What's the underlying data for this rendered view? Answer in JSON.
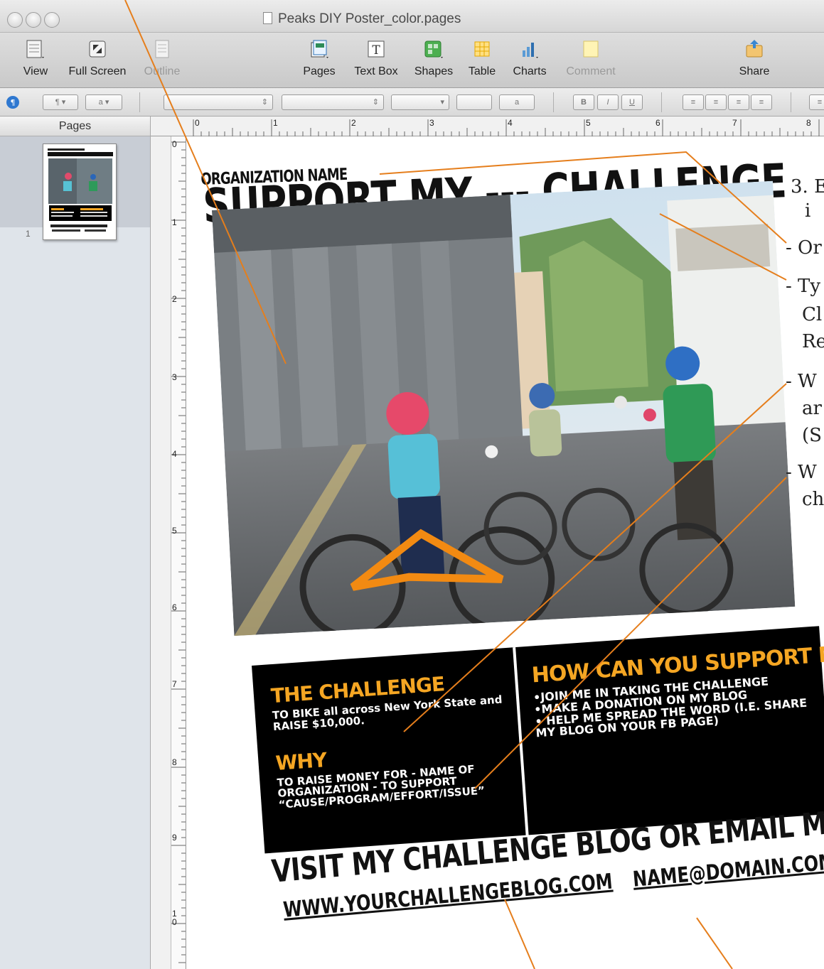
{
  "window": {
    "title": "Peaks DIY Poster_color.pages"
  },
  "toolbar": {
    "view": "View",
    "full_screen": "Full Screen",
    "outline": "Outline",
    "pages": "Pages",
    "text_box": "Text Box",
    "shapes": "Shapes",
    "table": "Table",
    "charts": "Charts",
    "comment": "Comment",
    "share": "Share"
  },
  "format_bar": {
    "bold": "B",
    "italic": "I",
    "underline": "U"
  },
  "sidebar": {
    "title": "Pages",
    "page_number": "1"
  },
  "ruler": {
    "h_ticks": [
      "0",
      "1",
      "2",
      "3",
      "4",
      "5",
      "6",
      "7",
      "8"
    ],
    "v_ticks": [
      "0",
      "1",
      "2",
      "3",
      "4",
      "5",
      "6",
      "7",
      "8",
      "9",
      "1 0"
    ]
  },
  "poster": {
    "org_name": "ORGANIZATION NAME",
    "headline": "SUPPORT MY --- CHALLENGE",
    "challenge_head": "THE CHALLENGE",
    "challenge_body": "TO BIKE all across New York State and RAISE $10,000.",
    "why_head": "WHY",
    "why_body": "TO RAISE MONEY FOR - NAME OF ORGANIZATION - TO SUPPORT “CAUSE/PROGRAM/EFFORT/ISSUE”",
    "support_head": "HOW CAN YOU SUPPORT ME?",
    "support_items": [
      "•JOIN ME IN TAKING THE CHALLENGE",
      "•MAKE A DONATION ON MY BLOG",
      "• HELP ME SPREAD THE WORD (I.E. SHARE MY BLOG ON YOUR FB PAGE)"
    ],
    "visit": "VISIT MY CHALLENGE BLOG OR EMAIL ME:",
    "blog_url": "WWW.YOURCHALLENGEBLOG.COM",
    "email": "NAME@DOMAIN.COM"
  },
  "annotations": {
    "step": "3. E",
    "step_cont": "i",
    "org": "- Or",
    "type_1": "- Ty",
    "type_2": "Cl",
    "type_3": "Re",
    "what_1": "- W",
    "what_2": "ar",
    "what_3": "(S",
    "why_1": "- W",
    "why_2": "ch"
  }
}
